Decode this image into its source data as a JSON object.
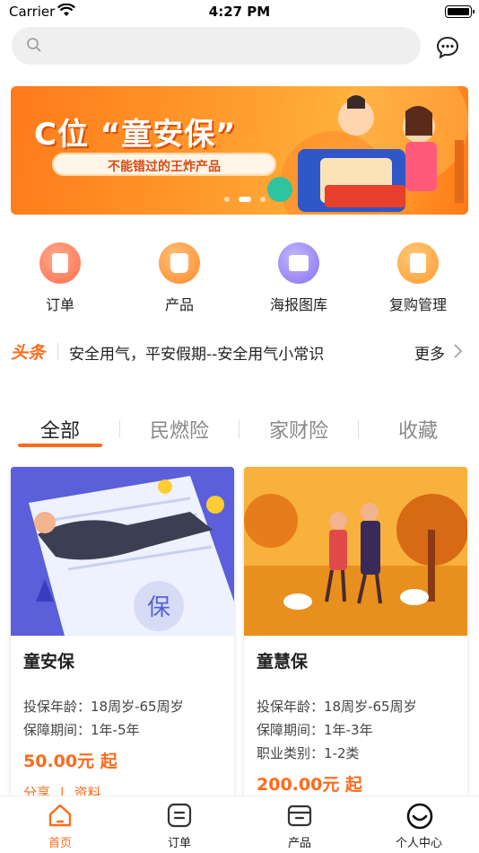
{
  "status_bar": {
    "carrier": "Carrier",
    "time": "4:27 PM"
  },
  "search": {
    "placeholder": ""
  },
  "banner": {
    "title": "C位 “童安保”",
    "subtitle": "不能错过的王炸产品",
    "page_count": 3,
    "active_page": 2
  },
  "quick_nav": [
    {
      "label": "订单",
      "icon": "order-icon",
      "color": "#ff7a5c"
    },
    {
      "label": "产品",
      "icon": "bag-icon",
      "color": "#ff9a3c"
    },
    {
      "label": "海报图库",
      "icon": "image-icon",
      "color": "#9b87f5"
    },
    {
      "label": "复购管理",
      "icon": "settings-doc-icon",
      "color": "#ffa24a"
    }
  ],
  "headline": {
    "tag": "头条",
    "text": "安全用气，平安假期--安全用气小常识",
    "more": "更多"
  },
  "tabs": [
    "全部",
    "民燃险",
    "家财险",
    "收藏"
  ],
  "active_tab": 0,
  "products": [
    {
      "name": "童安保",
      "lines": [
        "投保年龄：18周岁-65周岁",
        "保障期间：1年-5年"
      ],
      "price": "50.00元 起",
      "actions": [
        "分享",
        "资料"
      ]
    },
    {
      "name": "童慧保",
      "lines": [
        "投保年龄：18周岁-65周岁",
        "保障期间：1年-3年",
        "职业类别：1-2类"
      ],
      "price": "200.00元 起",
      "actions": []
    }
  ],
  "tabbar": [
    {
      "label": "首页",
      "icon": "home-icon",
      "active": true
    },
    {
      "label": "订单",
      "icon": "list-icon",
      "active": false
    },
    {
      "label": "产品",
      "icon": "box-icon",
      "active": false
    },
    {
      "label": "个人中心",
      "icon": "profile-icon",
      "active": false
    }
  ],
  "colors": {
    "accent": "#ff6a1a",
    "text": "#222222",
    "muted": "#888888"
  }
}
